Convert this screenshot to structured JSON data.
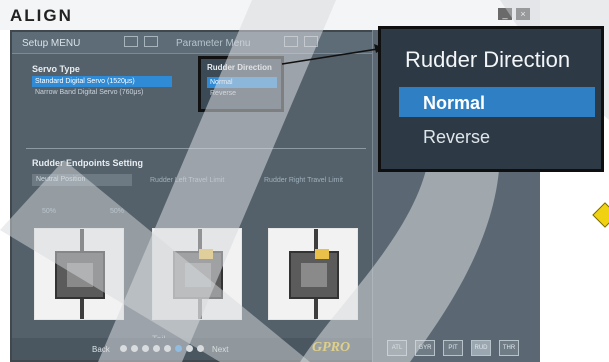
{
  "app": {
    "brand": "ALIGN",
    "window_buttons": [
      "_",
      "×"
    ]
  },
  "tabs": [
    {
      "label": "Setup MENU"
    },
    {
      "label": "Parameter Menu"
    }
  ],
  "servo_type": {
    "title": "Servo Type",
    "options": [
      "Standard Digital Servo (1520μs)",
      "Narrow Band Digital Servo (760μs)"
    ],
    "selected_index": 0
  },
  "rudder_direction": {
    "title": "Rudder Direction",
    "options": [
      "Normal",
      "Reverse"
    ],
    "selected_index": 0
  },
  "callout": {
    "title": "Rudder Direction",
    "options": [
      "Normal",
      "Reverse"
    ],
    "selected_index": 0
  },
  "endpoints": {
    "title": "Rudder Endpoints Setting",
    "position_field": "Neutral Position",
    "left_label": "Rudder Left Travel Limit",
    "right_label": "Rudder Right Travel Limit",
    "percent_left": "50%",
    "percent_mid": "50%"
  },
  "footer": {
    "section_label": "Tail",
    "back_label": "Back",
    "next_label": "Next",
    "logo_text": "GPRO"
  },
  "side_icons": [
    "ATL",
    "GYR",
    "PIT",
    "RUD",
    "THR"
  ]
}
